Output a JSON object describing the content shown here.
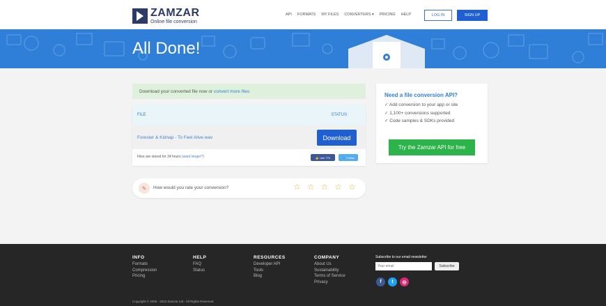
{
  "header": {
    "logo_name": "ZAMZAR",
    "logo_tagline": "Online file conversion",
    "nav": [
      "API",
      "FORMATS",
      "MY FILES",
      "CONVERTERS ▾",
      "PRICING",
      "HELP"
    ],
    "login_label": "LOG IN",
    "signup_label": "SIGN UP"
  },
  "banner": {
    "title": "All Done!"
  },
  "notice": {
    "text": "Download your converted file now or ",
    "link": "convert more files"
  },
  "file_table": {
    "col_file": "FILE",
    "col_status": "STATUS",
    "file_name": "Forester & Kidnap - To Feel Alive.wav",
    "download_label": "Download",
    "storage_text": "Files are stored for 24 hours ",
    "storage_link": "(want longer?)",
    "like_label": "👍 Like 77K",
    "follow_label": "🐦 Follow"
  },
  "rating": {
    "question": "How would you rate your conversion?",
    "stars": 5
  },
  "api_card": {
    "title": "Need a file conversion API?",
    "items": [
      "Add conversion to your app or site",
      "1,100+ conversions supported",
      "Code samples & SDKs provided"
    ],
    "button_label": "Try the Zamzar API for free"
  },
  "footer": {
    "columns": [
      {
        "title": "INFO",
        "links": [
          "Formats",
          "Compression",
          "Pricing"
        ]
      },
      {
        "title": "HELP",
        "links": [
          "FAQ",
          "Status"
        ]
      },
      {
        "title": "RESOURCES",
        "links": [
          "Developer API",
          "Tools",
          "Blog"
        ]
      },
      {
        "title": "COMPANY",
        "links": [
          "About Us",
          "Sustainability",
          "Terms of Service",
          "Privacy"
        ]
      }
    ],
    "newsletter_title": "Subscribe to our email newsletter",
    "email_placeholder": "Your email",
    "subscribe_label": "Subscribe",
    "copyright": "Copyright © 2006 - 2023 Zamzar Ltd - All Rights Reserved"
  },
  "colors": {
    "primary": "#1f5fd1",
    "banner": "#2f7fd8",
    "success": "#2cb34a",
    "footer_bg": "#262626"
  },
  "icons": {
    "rate": "pencil-icon",
    "star": "star-outline-icon",
    "social": [
      "facebook-icon",
      "twitter-icon",
      "instagram-icon"
    ]
  }
}
